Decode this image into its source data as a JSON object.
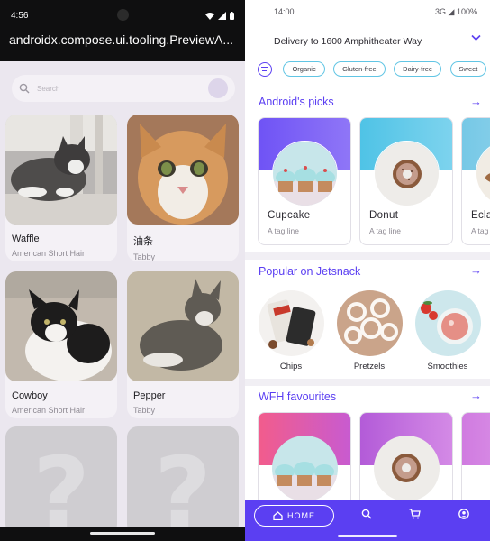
{
  "left_app": {
    "status_time": "4:56",
    "title": "androidx.compose.ui.tooling.PreviewA...",
    "search_placeholder": "Search",
    "cats": [
      {
        "name": "Waffle",
        "breed": "American Short Hair"
      },
      {
        "name": "油条",
        "breed": "Tabby"
      },
      {
        "name": "Cowboy",
        "breed": "American Short Hair"
      },
      {
        "name": "Pepper",
        "breed": "Tabby"
      }
    ],
    "placeholder_glyph": "?"
  },
  "right_app": {
    "status_time": "14:00",
    "status_icons": "3G ◢ 100%",
    "delivery": "Delivery to 1600 Amphitheater Way",
    "filters": [
      "Organic",
      "Gluten-free",
      "Dairy-free",
      "Sweet"
    ],
    "sections": {
      "picks": "Android's picks",
      "popular": "Popular on Jetsnack",
      "wfh": "WFH favourites"
    },
    "picks": [
      {
        "name": "Cupcake",
        "tag": "A tag line"
      },
      {
        "name": "Donut",
        "tag": "A tag line"
      },
      {
        "name": "Ecla",
        "tag": "A tag"
      }
    ],
    "popular": [
      "Chips",
      "Pretzels",
      "Smoothies"
    ],
    "nav": {
      "home": "HOME"
    },
    "colors": {
      "accent": "#5b3ff2",
      "chip_border": "#61c5e4"
    }
  }
}
